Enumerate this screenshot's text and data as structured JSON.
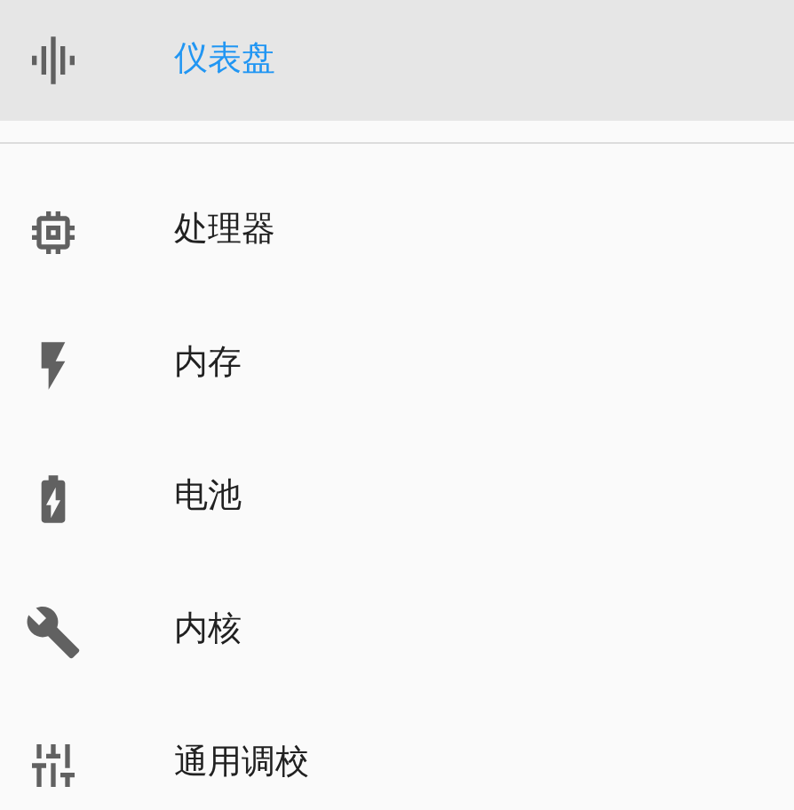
{
  "sections": [
    {
      "items": [
        {
          "label": "仪表盘",
          "selected": true
        }
      ]
    },
    {
      "items": [
        {
          "label": "处理器",
          "selected": false
        },
        {
          "label": "内存",
          "selected": false
        },
        {
          "label": "电池",
          "selected": false
        },
        {
          "label": "内核",
          "selected": false
        },
        {
          "label": "通用调校",
          "selected": false
        }
      ]
    }
  ]
}
